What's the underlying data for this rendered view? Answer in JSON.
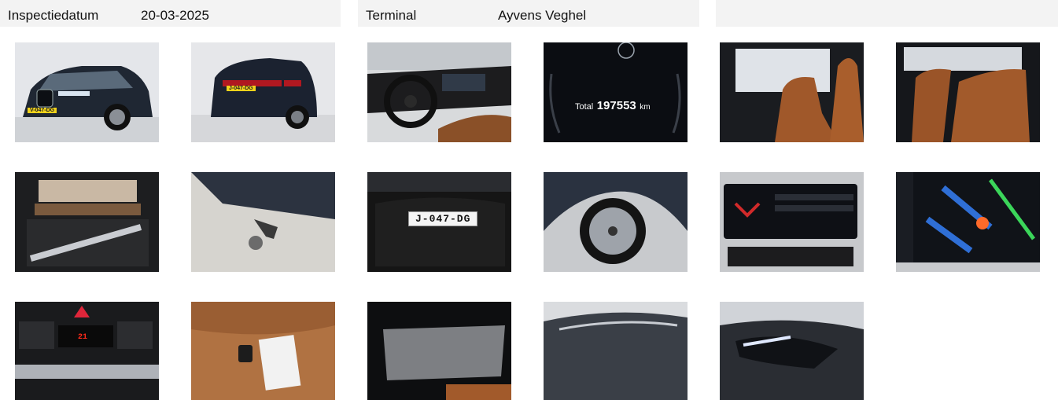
{
  "header": {
    "inspection_label": "Inspectiedatum",
    "inspection_date": "20-03-2025",
    "terminal_label": "Terminal",
    "terminal_value": "Ayvens Veghel"
  },
  "photos": {
    "front_plate": "V-047-DG",
    "rear_plate": "J-047-DG",
    "spare_plate": "J-047-DG",
    "odometer_label": "Total",
    "odometer_value": "197553",
    "odometer_unit": "km",
    "climate_temp": "21"
  }
}
